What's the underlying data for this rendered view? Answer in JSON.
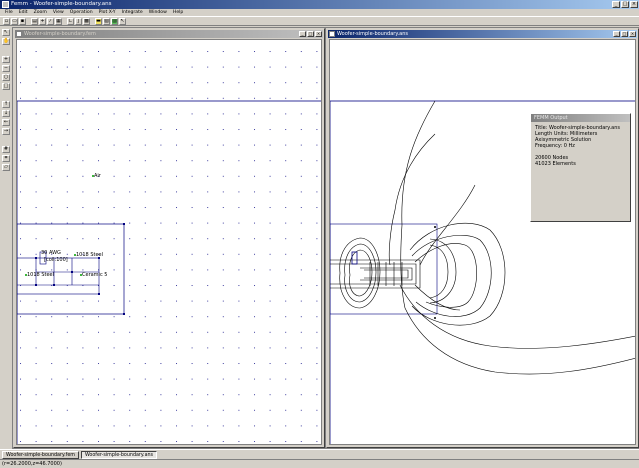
{
  "window": {
    "title": "Femm - Woofer-simple-boundary.ans"
  },
  "menu": [
    "File",
    "Edit",
    "Zoom",
    "View",
    "Operation",
    "Plot X-Y",
    "Integrate",
    "Window",
    "Help"
  ],
  "toolbar_icons": [
    "new-icon",
    "open-icon",
    "save-icon",
    "print-icon",
    "point-mode-icon",
    "contour-icon",
    "area-icon",
    "xy-plot-icon",
    "integrate-icon",
    "density-icon",
    "vector-icon",
    "smooth-icon"
  ],
  "left_tools": [
    "select-icon",
    "pan-icon",
    "zoom-in-icon",
    "zoom-out-icon",
    "zoom-natural-icon",
    "zoom-window-icon",
    "up-icon",
    "down-icon",
    "left-icon",
    "right-icon",
    "grid-icon",
    "snap-icon",
    "show-mesh-icon"
  ],
  "windows": {
    "left": {
      "title": "Woofer-simple-boundary.fem",
      "labels": {
        "air": "Air",
        "awg": "30 AWG",
        "coil": "[coil:100]",
        "steel_top": "1018 Steel",
        "steel_left": "1018 Steel",
        "ceramic": "Ceramic 5"
      }
    },
    "right": {
      "title": "Woofer-simple-boundary.ans"
    }
  },
  "output": {
    "title": "FEMM Output",
    "lines_top": [
      "Title: Woofer-simple-boundary.ans",
      "Length Units: Millimeters",
      "Axisymmetric Solution",
      "Frequency: 0 Hz"
    ],
    "lines_bottom": [
      "20600 Nodes",
      "41023 Elements"
    ]
  },
  "taskbar": {
    "items": [
      "Woofer-simple-boundary.fem",
      "Woofer-simple-boundary.ans"
    ]
  },
  "status": {
    "coords": "(r=26.2000,z=46.7000)"
  },
  "colors": {
    "title_active": "#0a246a",
    "geometry": "#00007f",
    "grid": "#0000aa"
  }
}
